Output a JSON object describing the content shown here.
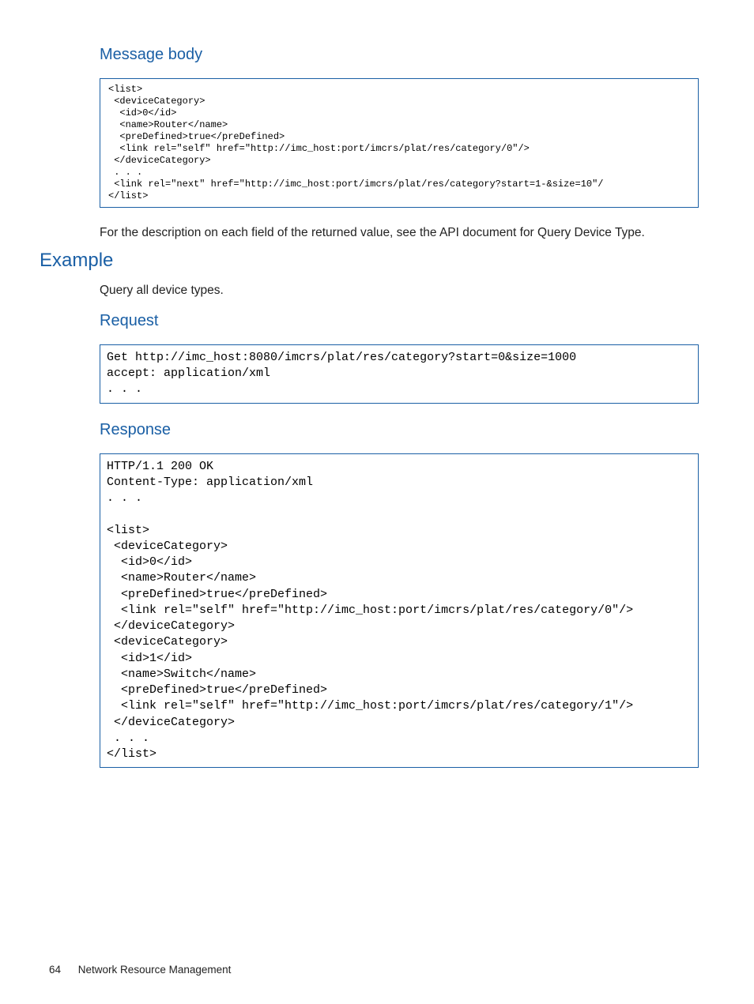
{
  "headings": {
    "message_body": "Message body",
    "example": "Example",
    "request": "Request",
    "response": "Response"
  },
  "code": {
    "message_body": "<list>\n <deviceCategory>\n  <id>0</id>\n  <name>Router</name>\n  <preDefined>true</preDefined>\n  <link rel=\"self\" href=\"http://imc_host:port/imcrs/plat/res/category/0\"/>\n </deviceCategory>\n . . .\n <link rel=\"next\" href=\"http://imc_host:port/imcrs/plat/res/category?start=1-&size=10\"/\n</list>",
    "request": "Get http://imc_host:8080/imcrs/plat/res/category?start=0&size=1000\naccept: application/xml\n. . .",
    "response": "HTTP/1.1 200 OK\nContent-Type: application/xml\n. . .\n\n<list>\n <deviceCategory>\n  <id>0</id>\n  <name>Router</name>\n  <preDefined>true</preDefined>\n  <link rel=\"self\" href=\"http://imc_host:port/imcrs/plat/res/category/0\"/>\n </deviceCategory>\n <deviceCategory>\n  <id>1</id>\n  <name>Switch</name>\n  <preDefined>true</preDefined>\n  <link rel=\"self\" href=\"http://imc_host:port/imcrs/plat/res/category/1\"/>\n </deviceCategory>\n . . .\n</list>"
  },
  "paragraphs": {
    "desc_note": "For the description on each field of the returned value, see the API document for Query Device Type.",
    "example_intro": "Query all device types."
  },
  "footer": {
    "page_number": "64",
    "section": "Network Resource Management"
  }
}
